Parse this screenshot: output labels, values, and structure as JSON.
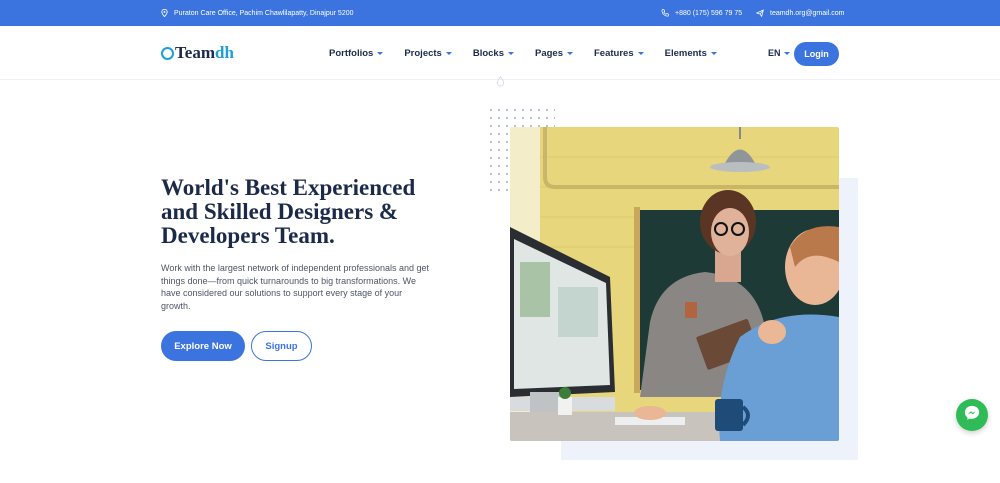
{
  "topbar": {
    "address": "Puraton Care Office, Pachim Chawlilapatty, Dinajpur 5200",
    "phone": "+880 (175) 596 79 75",
    "email": "teamdh.org@gmail.com"
  },
  "logo": {
    "part1": "Team",
    "part2": "dh"
  },
  "nav": {
    "items": [
      {
        "label": "Portfolios"
      },
      {
        "label": "Projects"
      },
      {
        "label": "Blocks"
      },
      {
        "label": "Pages"
      },
      {
        "label": "Features"
      },
      {
        "label": "Elements"
      }
    ]
  },
  "header": {
    "language": "EN",
    "login_label": "Login"
  },
  "hero": {
    "title": "World's Best Experienced and Skilled Designers & Developers Team.",
    "description": "Work with the largest network of independent professionals and get things done—from quick turnarounds to big transformations. We have considered our solutions to support every stage of your growth.",
    "explore_label": "Explore Now",
    "signup_label": "Signup"
  },
  "colors": {
    "primary": "#3b74de",
    "logo_accent": "#1e9fd8",
    "heading": "#1c2a4a",
    "messenger": "#2fbb57"
  },
  "icons": [
    "location-icon",
    "phone-icon",
    "mail-icon",
    "messenger-icon"
  ]
}
